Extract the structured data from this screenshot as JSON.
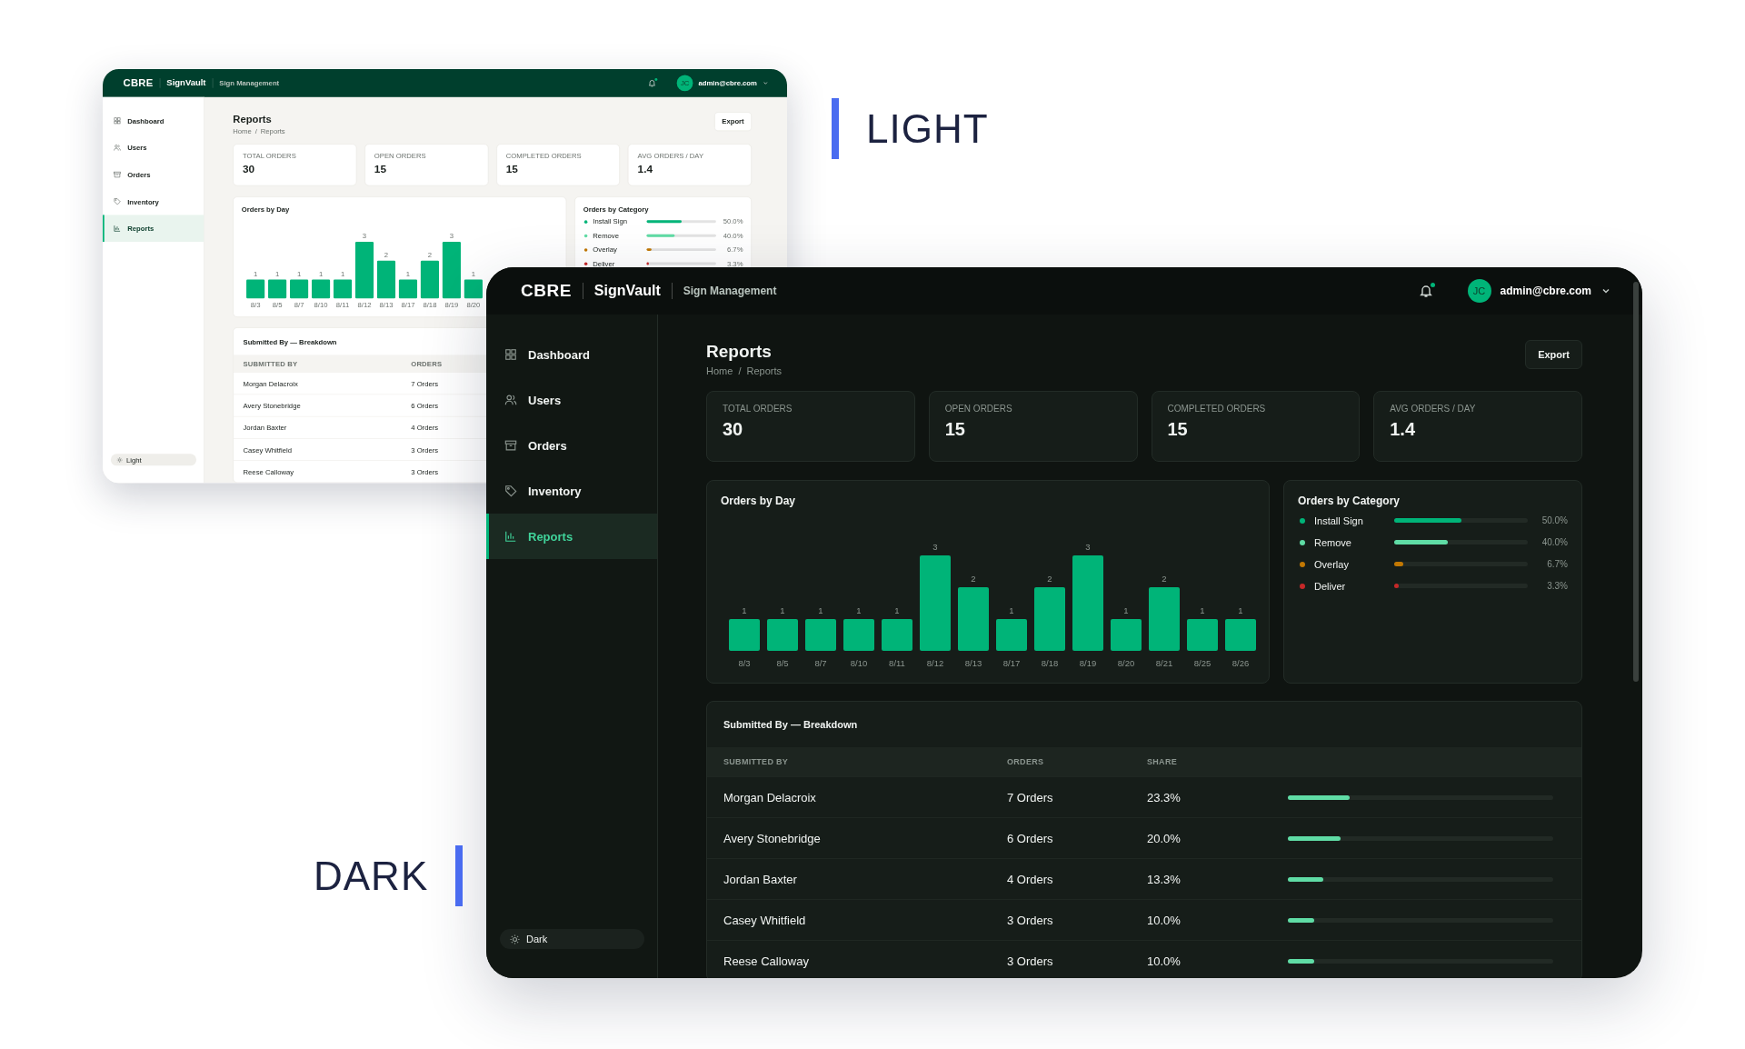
{
  "showcase_labels": [
    {
      "text": "LIGHT"
    },
    {
      "text": "DARK"
    }
  ],
  "screens": [
    {
      "kind": "light",
      "header": {
        "logo": "CBRE",
        "app": "SignVault",
        "subtitle": "Sign Management",
        "notification": true,
        "avatar": "JC",
        "user": "admin@cbre.com"
      },
      "sidebar": {
        "items": [
          {
            "label": "Dashboard",
            "selected": false
          },
          {
            "label": "Users",
            "selected": false
          },
          {
            "label": "Orders",
            "selected": false
          },
          {
            "label": "Inventory",
            "selected": false
          },
          {
            "label": "Reports",
            "selected": true
          }
        ],
        "theme_toggle": "Light"
      },
      "page": {
        "title": "Reports",
        "breadcrumb": "Home / Reports",
        "export": "Export"
      },
      "stats": [
        {
          "label": "TOTAL ORDERS",
          "value": "30"
        },
        {
          "label": "OPEN ORDERS",
          "value": "15"
        },
        {
          "label": "COMPLETED ORDERS",
          "value": "15"
        },
        {
          "label": "AVG ORDERS / DAY",
          "value": "1.4"
        }
      ],
      "orders_by_day": {
        "title": "Orders by Day",
        "chart_data": {
          "type": "bar",
          "categories": [
            "8/3",
            "8/5",
            "8/7",
            "8/10",
            "8/11",
            "8/12",
            "8/13",
            "8/17",
            "8/18",
            "8/19",
            "8/20"
          ],
          "values": [
            1,
            1,
            1,
            1,
            1,
            3,
            2,
            1,
            2,
            3,
            1
          ],
          "data_labels": true
        }
      },
      "orders_by_category": {
        "title": "Orders by Category",
        "items": [
          {
            "label": "Install Sign",
            "level": 0.5,
            "reading": "50.0%",
            "color": "#00b478"
          },
          {
            "label": "Remove",
            "level": 0.4,
            "reading": "40.0%",
            "color": "#5fdca5"
          },
          {
            "label": "Overlay",
            "level": 0.067,
            "reading": "6.7%",
            "color": "#c27803"
          },
          {
            "label": "Deliver",
            "level": 0.033,
            "reading": "3.3%",
            "color": "#c62828"
          }
        ]
      },
      "breakdown": {
        "title": "Submitted By — Breakdown",
        "columns": [
          "SUBMITTED BY",
          "ORDERS"
        ],
        "rows": [
          {
            "name": "Morgan Delacroix",
            "orders": "7 Orders"
          },
          {
            "name": "Avery Stonebridge",
            "orders": "6 Orders"
          },
          {
            "name": "Jordan Baxter",
            "orders": "4 Orders"
          },
          {
            "name": "Casey Whitfield",
            "orders": "3 Orders"
          },
          {
            "name": "Reese Calloway",
            "orders": "3 Orders"
          }
        ]
      }
    },
    {
      "kind": "dark",
      "header": {
        "logo": "CBRE",
        "app": "SignVault",
        "subtitle": "Sign Management",
        "notification": true,
        "avatar": "JC",
        "user": "admin@cbre.com"
      },
      "sidebar": {
        "items": [
          {
            "label": "Dashboard",
            "selected": false
          },
          {
            "label": "Users",
            "selected": false
          },
          {
            "label": "Orders",
            "selected": false
          },
          {
            "label": "Inventory",
            "selected": false
          },
          {
            "label": "Reports",
            "selected": true
          }
        ],
        "theme_toggle": "Dark"
      },
      "page": {
        "title": "Reports",
        "breadcrumb": "Home / Reports",
        "export": "Export"
      },
      "stats": [
        {
          "label": "TOTAL ORDERS",
          "value": "30"
        },
        {
          "label": "OPEN ORDERS",
          "value": "15"
        },
        {
          "label": "COMPLETED ORDERS",
          "value": "15"
        },
        {
          "label": "AVG ORDERS / DAY",
          "value": "1.4"
        }
      ],
      "orders_by_day": {
        "title": "Orders by Day",
        "chart_data": {
          "type": "bar",
          "categories": [
            "8/3",
            "8/5",
            "8/7",
            "8/10",
            "8/11",
            "8/12",
            "8/13",
            "8/17",
            "8/18",
            "8/19",
            "8/20",
            "8/21",
            "8/25",
            "8/26"
          ],
          "values": [
            1,
            1,
            1,
            1,
            1,
            3,
            2,
            1,
            2,
            3,
            1,
            2,
            1,
            1
          ],
          "data_labels": true
        }
      },
      "orders_by_category": {
        "title": "Orders by Category",
        "items": [
          {
            "label": "Install Sign",
            "level": 0.5,
            "reading": "50.0%",
            "color": "#00b478"
          },
          {
            "label": "Remove",
            "level": 0.4,
            "reading": "40.0%",
            "color": "#5fdca5"
          },
          {
            "label": "Overlay",
            "level": 0.067,
            "reading": "6.7%",
            "color": "#c27803"
          },
          {
            "label": "Deliver",
            "level": 0.033,
            "reading": "3.3%",
            "color": "#c62828"
          }
        ]
      },
      "breakdown": {
        "title": "Submitted By — Breakdown",
        "columns": [
          "SUBMITTED BY",
          "ORDERS",
          "SHARE"
        ],
        "rows": [
          {
            "name": "Morgan Delacroix",
            "orders": "7 Orders",
            "share": "23.3%",
            "level": 0.233
          },
          {
            "name": "Avery Stonebridge",
            "orders": "6 Orders",
            "share": "20.0%",
            "level": 0.2
          },
          {
            "name": "Jordan Baxter",
            "orders": "4 Orders",
            "share": "13.3%",
            "level": 0.133
          },
          {
            "name": "Casey Whitfield",
            "orders": "3 Orders",
            "share": "10.0%",
            "level": 0.1
          },
          {
            "name": "Reese Calloway",
            "orders": "3 Orders",
            "share": "10.0%",
            "level": 0.1
          }
        ]
      }
    }
  ]
}
